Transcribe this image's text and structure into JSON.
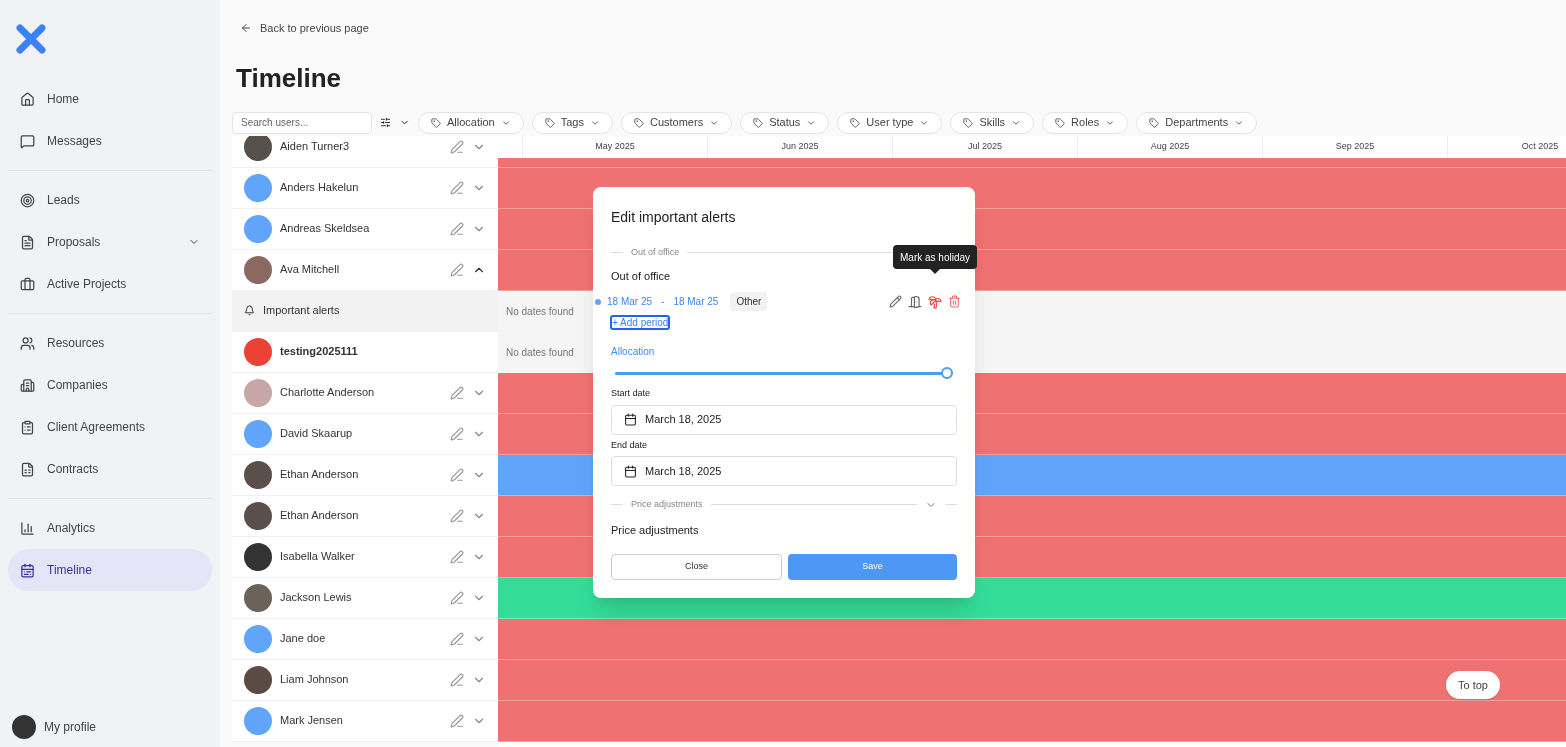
{
  "sidebar": {
    "groups": [
      [
        {
          "label": "Home",
          "selected": false
        },
        {
          "label": "Messages",
          "selected": false
        }
      ],
      [
        {
          "label": "Leads",
          "selected": false
        },
        {
          "label": "Proposals",
          "selected": false,
          "expandable": true
        },
        {
          "label": "Active Projects",
          "selected": false
        }
      ],
      [
        {
          "label": "Resources",
          "selected": false
        },
        {
          "label": "Companies",
          "selected": false
        },
        {
          "label": "Client Agreements",
          "selected": false
        },
        {
          "label": "Contracts",
          "selected": false
        }
      ],
      [
        {
          "label": "Analytics",
          "selected": false
        },
        {
          "label": "Timeline",
          "selected": true
        }
      ]
    ],
    "profile": "My profile"
  },
  "back_link": "Back to previous page",
  "page_title": "Timeline",
  "search": {
    "placeholder": "Search users..."
  },
  "filters": [
    "Allocation",
    "Tags",
    "Customers",
    "Status",
    "User type",
    "Skills",
    "Roles",
    "Departments"
  ],
  "months": [
    "May 2025",
    "Jun 2025",
    "Jul 2025",
    "Aug 2025",
    "Sep 2025",
    "Oct 2025"
  ],
  "rows": [
    {
      "kind": "person",
      "name": "Aiden Turner3",
      "avatar": {
        "color": "#55504c"
      },
      "expanded": false,
      "color": "#f07171"
    },
    {
      "kind": "person",
      "name": "Anders Hakelun",
      "avatar": {
        "color": "#60a5fa"
      },
      "expanded": false,
      "color": "#f07171"
    },
    {
      "kind": "person",
      "name": "Andreas Skeldsea",
      "avatar": {
        "color": "#60a5fa"
      },
      "expanded": false,
      "color": "#f07171"
    },
    {
      "kind": "person",
      "name": "Ava Mitchell",
      "avatar": {
        "color": "#8a6a60"
      },
      "expanded": true,
      "color": "#f07171"
    },
    {
      "kind": "group",
      "name": "Important alerts",
      "empty_text": "No dates found"
    },
    {
      "kind": "account",
      "name": "testing2025111",
      "avatar": {
        "color": "#ea4335"
      },
      "empty_text": "No dates found"
    },
    {
      "kind": "person",
      "name": "Charlotte Anderson",
      "avatar": {
        "color": "#c9a6a6"
      },
      "expanded": false,
      "color": "#f07171"
    },
    {
      "kind": "person",
      "name": "David Skaarup",
      "avatar": {
        "color": "#60a5fa"
      },
      "expanded": false,
      "color": "#f07171"
    },
    {
      "kind": "person",
      "name": "Ethan Anderson",
      "avatar": {
        "color": "#5a4f4a"
      },
      "expanded": false,
      "color": "#60a5fa"
    },
    {
      "kind": "person",
      "name": "Ethan Anderson",
      "avatar": {
        "color": "#5a4f4a"
      },
      "expanded": false,
      "color": "#f07171"
    },
    {
      "kind": "person",
      "name": "Isabella Walker",
      "avatar": {
        "color": "#333333"
      },
      "expanded": false,
      "color": "#f07171"
    },
    {
      "kind": "person",
      "name": "Jackson Lewis",
      "avatar": {
        "color": "#6b625a"
      },
      "expanded": false,
      "color": "#34dc98"
    },
    {
      "kind": "person",
      "name": "Jane doe",
      "avatar": {
        "color": "#60a5fa"
      },
      "expanded": false,
      "color": "#f07171"
    },
    {
      "kind": "person",
      "name": "Liam Johnson",
      "avatar": {
        "color": "#5c4a44"
      },
      "expanded": false,
      "color": "#f07171"
    },
    {
      "kind": "person",
      "name": "Mark Jensen",
      "avatar": {
        "color": "#60a5fa"
      },
      "expanded": false,
      "color": "#f07171"
    }
  ],
  "to_top": "To top",
  "dialog": {
    "title": "Edit important alerts",
    "section_1": "Out of office",
    "heading_1": "Out of office",
    "period": {
      "start": "18 Mar 25",
      "separator": "-",
      "end": "18 Mar 25",
      "tag": "Other"
    },
    "add_period": "+ Add period",
    "allocation": {
      "label": "Allocation",
      "level": 1
    },
    "start_date": {
      "label": "Start date",
      "value": "March 18, 2025"
    },
    "end_date": {
      "label": "End date",
      "value": "March 18, 2025"
    },
    "section_2": "Price adjustments",
    "heading_2": "Price adjustments",
    "buttons": {
      "close": "Close",
      "save": "Save"
    },
    "tooltip": "Mark as holiday"
  }
}
